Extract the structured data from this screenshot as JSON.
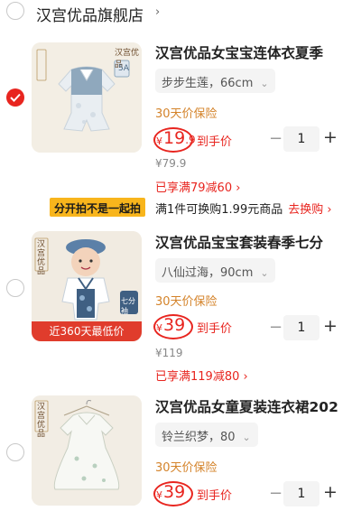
{
  "shop": {
    "name": "汉宫优品旗舰店",
    "chevron": "›"
  },
  "promo": {
    "badge": "分开拍不是一起拍",
    "text": "满1件可换购1.99元商品",
    "link": "去换购 ›"
  },
  "items": [
    {
      "checked": true,
      "title": "汉宫优品女宝宝连体衣夏季",
      "variant": "步步生莲，66cm",
      "warranty": "30天价保险",
      "currency": "¥",
      "price_int": "19",
      "price_dec": ".9",
      "price_label": "到手价",
      "original_price": "¥79.9",
      "discount": "已享满79减60 ›",
      "quantity": "1",
      "thumb_brand": "汉宫优品",
      "thumb_size": "5A"
    },
    {
      "checked": false,
      "title": "汉宫优品宝宝套装春季七分",
      "variant": "八仙过海，90cm",
      "warranty": "30天价保险",
      "currency": "¥",
      "price_int": "39",
      "price_dec": "",
      "price_label": "到手价",
      "original_price": "¥119",
      "discount": "已享满119减80 ›",
      "quantity": "1",
      "thumb_brand": "汉宫优品",
      "thumb_tag": "近360天最低价",
      "thumb_side": "七分袖"
    },
    {
      "checked": false,
      "title": "汉宫优品女童夏装连衣裙202",
      "variant": "铃兰织梦，80",
      "warranty": "30天价保险",
      "currency": "¥",
      "price_int": "39",
      "price_dec": "",
      "price_label": "到手价",
      "quantity": "1",
      "thumb_brand": "汉宫优品"
    }
  ],
  "stepper": {
    "minus": "−",
    "plus": "+"
  },
  "colors": {
    "accent": "#e8251f",
    "warranty": "#d4832a",
    "promo_badge": "#f8b51c"
  }
}
